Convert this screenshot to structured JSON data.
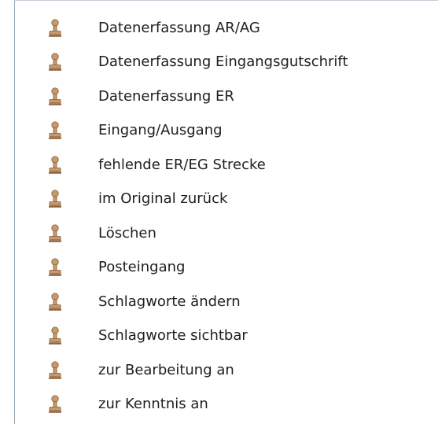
{
  "menu": {
    "icon": "rubber-stamp-icon",
    "icon_color": "#c89a6b",
    "items": [
      {
        "label": "Datenerfassung AR/AG"
      },
      {
        "label": "Datenerfassung Eingangsgutschrift"
      },
      {
        "label": "Datenerfassung ER"
      },
      {
        "label": "Eingang/Ausgang"
      },
      {
        "label": "fehlende ER/EG Strecke"
      },
      {
        "label": "im Original zurück"
      },
      {
        "label": "Löschen"
      },
      {
        "label": "Posteingang"
      },
      {
        "label": "Schlagworte ändern"
      },
      {
        "label": "Schlagworte sichtbar"
      },
      {
        "label": "zur Bearbeitung an"
      },
      {
        "label": "zur Kenntnis an"
      }
    ]
  }
}
